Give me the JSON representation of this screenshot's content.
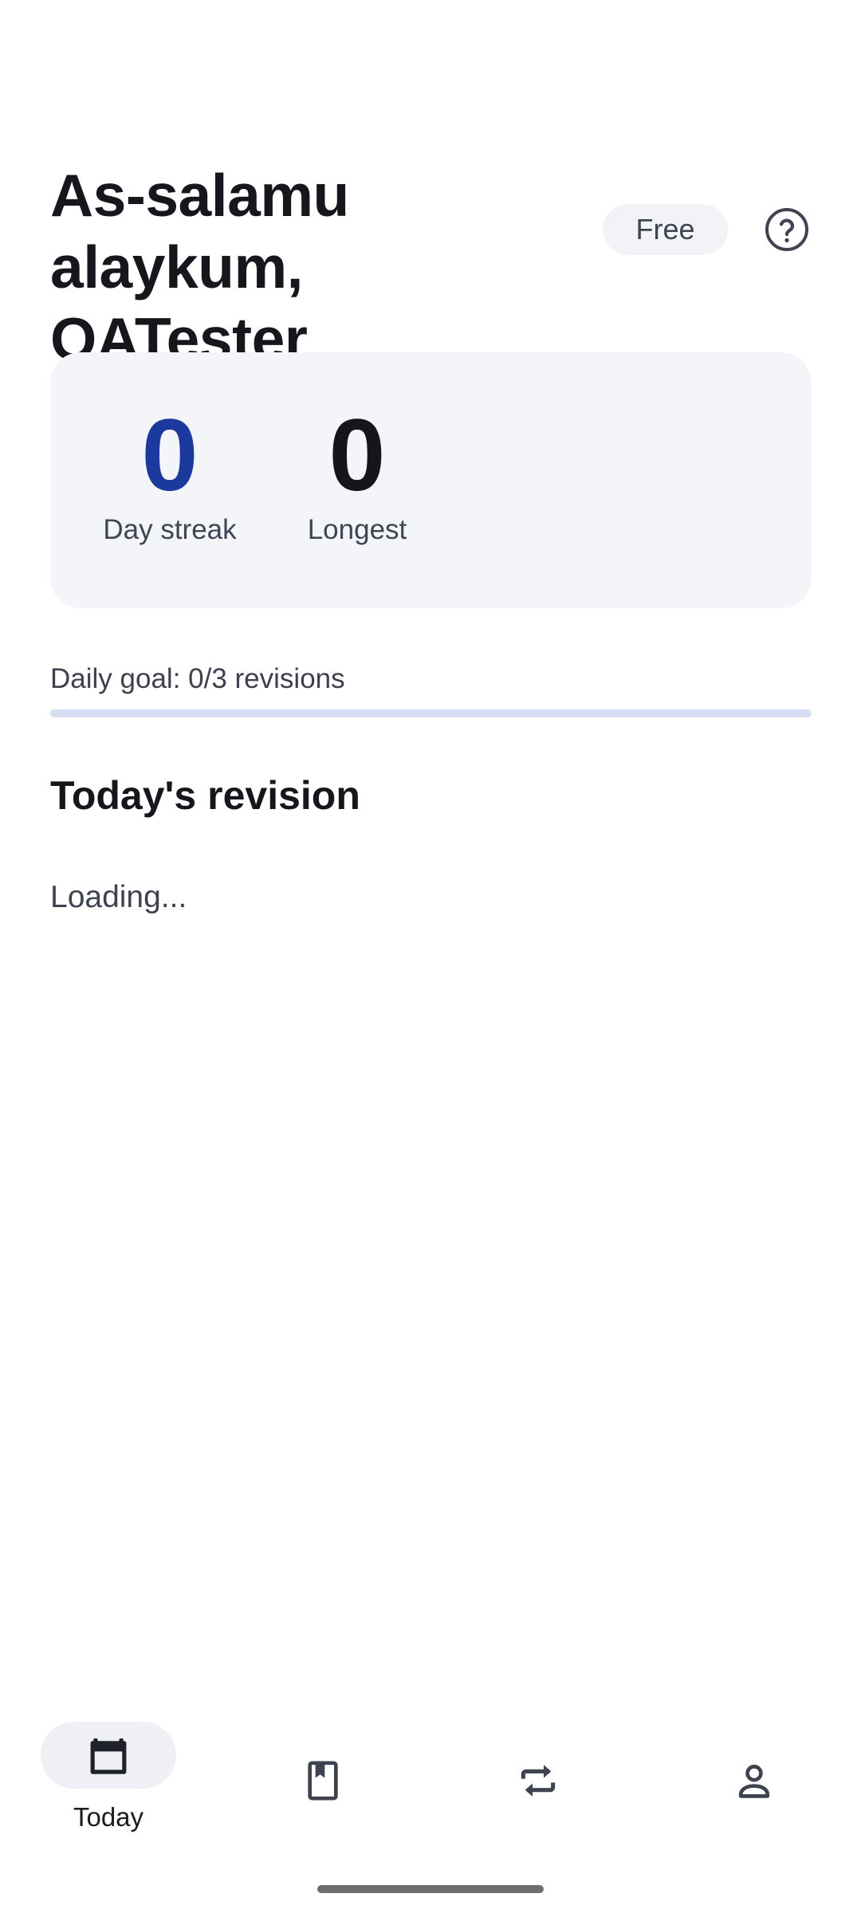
{
  "header": {
    "greeting": "As-salamu alaykum, QATester",
    "plan_badge": "Free",
    "help_icon": "help-circle-icon"
  },
  "streak": {
    "current_value": "0",
    "current_label": "Day streak",
    "longest_value": "0",
    "longest_label": "Longest"
  },
  "daily_goal": {
    "text": "Daily goal: 0/3 revisions",
    "progress_fraction": 0
  },
  "revision": {
    "title": "Today's revision",
    "status": "Loading..."
  },
  "bottom_nav": {
    "items": [
      {
        "label": "Today",
        "icon": "calendar-icon",
        "active": true
      },
      {
        "label": "",
        "icon": "bookmark-book-icon",
        "active": false
      },
      {
        "label": "",
        "icon": "repeat-icon",
        "active": false
      },
      {
        "label": "",
        "icon": "person-icon",
        "active": false
      }
    ]
  },
  "colors": {
    "accent": "#1c3a9e",
    "card_bg": "#f4f5f9",
    "progress_track": "#d6def3"
  }
}
